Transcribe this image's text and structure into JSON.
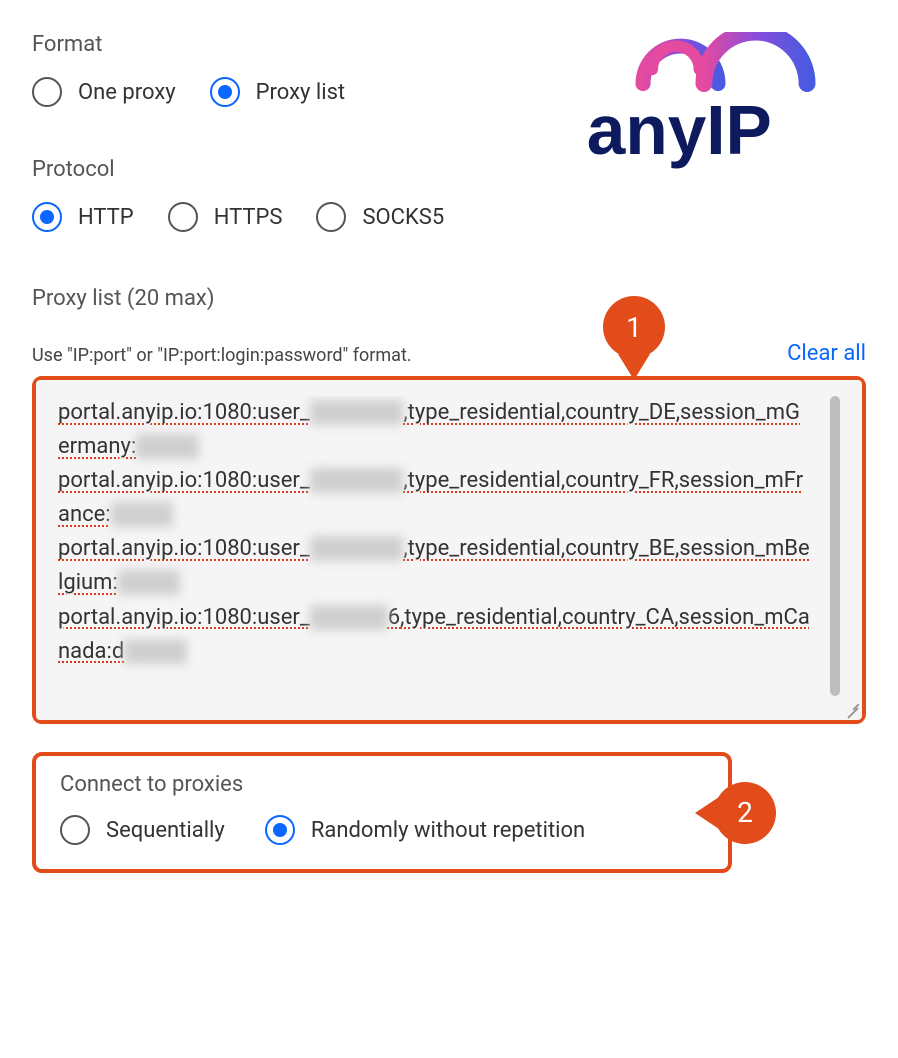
{
  "format": {
    "label": "Format",
    "options": {
      "one_proxy": "One proxy",
      "proxy_list": "Proxy list"
    },
    "selected": "proxy_list"
  },
  "protocol": {
    "label": "Protocol",
    "options": {
      "http": "HTTP",
      "https": "HTTPS",
      "socks5": "SOCKS5"
    },
    "selected": "http"
  },
  "proxy_list": {
    "heading": "Proxy list (20 max)",
    "hint": "Use \"IP:port\" or \"IP:port:login:password\" format.",
    "clear_all": "Clear all",
    "lines": [
      {
        "host": "portal.anyip.io",
        "port": "1080",
        "user_prefix": "user_",
        "user_masked": "██████",
        "params": ",type_residential,country_DE,session_mGermany:",
        "pass_masked": "████"
      },
      {
        "host": "portal.anyip.io",
        "port": "1080",
        "user_prefix": "user_",
        "user_masked": "██████",
        "params": ",type_residential,country_FR,session_mFrance:",
        "pass_masked": "████"
      },
      {
        "host": "portal.anyip.io",
        "port": "1080",
        "user_prefix": "user_",
        "user_masked": "██████",
        "params": ",type_residential,country_BE,session_mBelgium:",
        "pass_masked": "████"
      },
      {
        "host": "portal.anyip.io",
        "port": "1080",
        "user_prefix": "user_",
        "user_masked": "█████",
        "user_suffix": "6",
        "params": ",type_residential,country_CA,session_mCanada:d",
        "pass_masked": "████"
      }
    ]
  },
  "connect": {
    "label": "Connect to proxies",
    "options": {
      "seq": "Sequentially",
      "rand": "Randomly without repetition"
    },
    "selected": "rand"
  },
  "callouts": {
    "one": "1",
    "two": "2"
  },
  "logo_text": "anyIP"
}
